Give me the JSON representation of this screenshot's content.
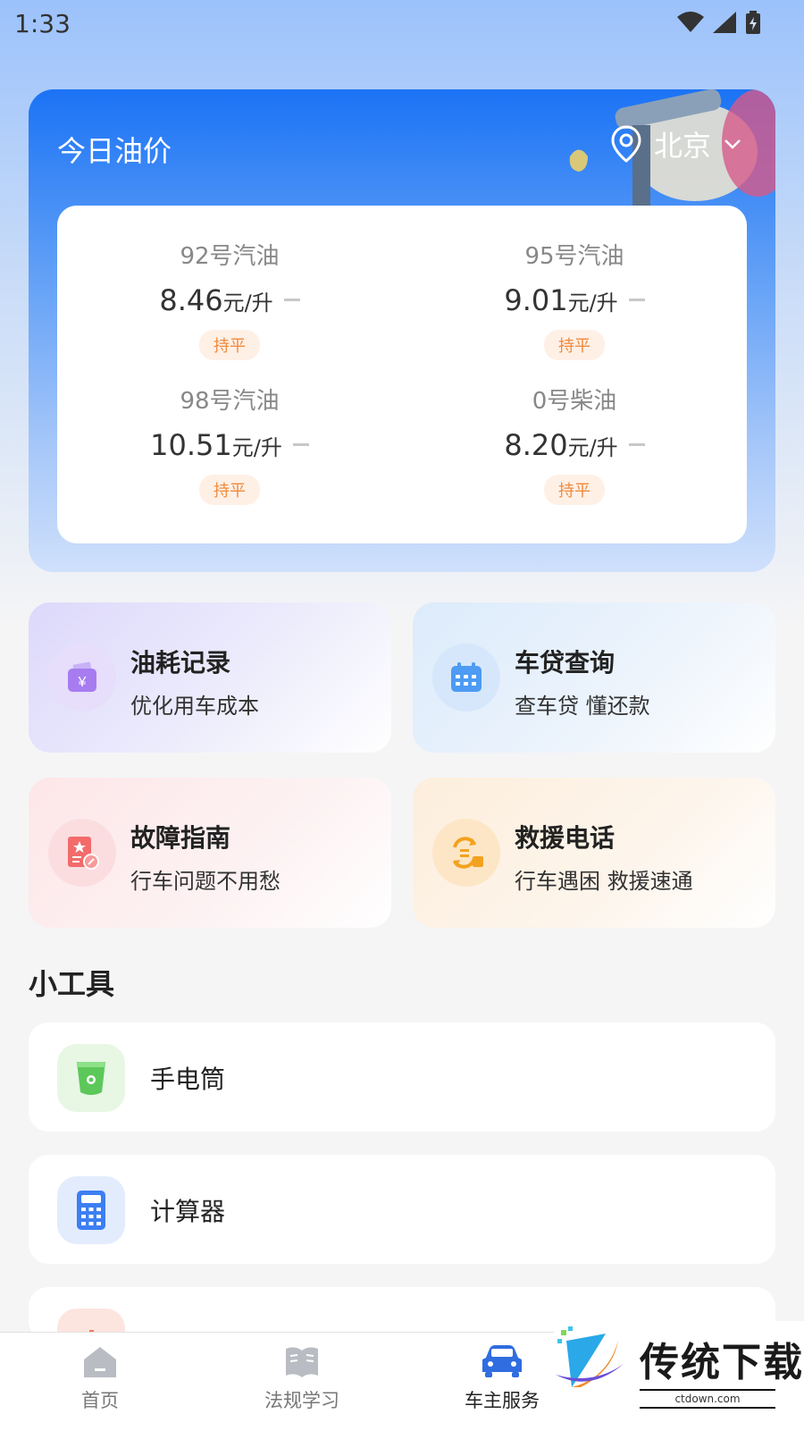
{
  "status_bar": {
    "time": "1:33"
  },
  "oil": {
    "title": "今日油价",
    "city": "北京",
    "prices": [
      {
        "name": "92号汽油",
        "value": "8.46",
        "unit": "元/升",
        "trend": "持平"
      },
      {
        "name": "95号汽油",
        "value": "9.01",
        "unit": "元/升",
        "trend": "持平"
      },
      {
        "name": "98号汽油",
        "value": "10.51",
        "unit": "元/升",
        "trend": "持平"
      },
      {
        "name": "0号柴油",
        "value": "8.20",
        "unit": "元/升",
        "trend": "持平"
      }
    ]
  },
  "services": [
    {
      "title": "油耗记录",
      "subtitle": "优化用车成本",
      "icon": "wallet-yen-icon",
      "color": "#a77cf0"
    },
    {
      "title": "车贷查询",
      "subtitle": "查车贷 懂还款",
      "icon": "calendar-icon",
      "color": "#4d9bf3"
    },
    {
      "title": "故障指南",
      "subtitle": "行车问题不用愁",
      "icon": "guide-book-icon",
      "color": "#f36b6b"
    },
    {
      "title": "救援电话",
      "subtitle": "行车遇困 救援速通",
      "icon": "rescue-exchange-icon",
      "color": "#f3a21f"
    }
  ],
  "tools": {
    "title": "小工具",
    "items": [
      {
        "label": "手电筒",
        "icon": "flashlight-icon"
      },
      {
        "label": "计算器",
        "icon": "calculator-icon"
      },
      {
        "label": "",
        "icon": "chart-icon"
      }
    ]
  },
  "nav": {
    "items": [
      {
        "label": "首页",
        "icon": "home-icon"
      },
      {
        "label": "法规学习",
        "icon": "book-icon"
      },
      {
        "label": "车主服务",
        "icon": "car-icon",
        "active": true
      }
    ]
  },
  "watermark": {
    "text": "传统下载",
    "url": "ctdown.com"
  }
}
